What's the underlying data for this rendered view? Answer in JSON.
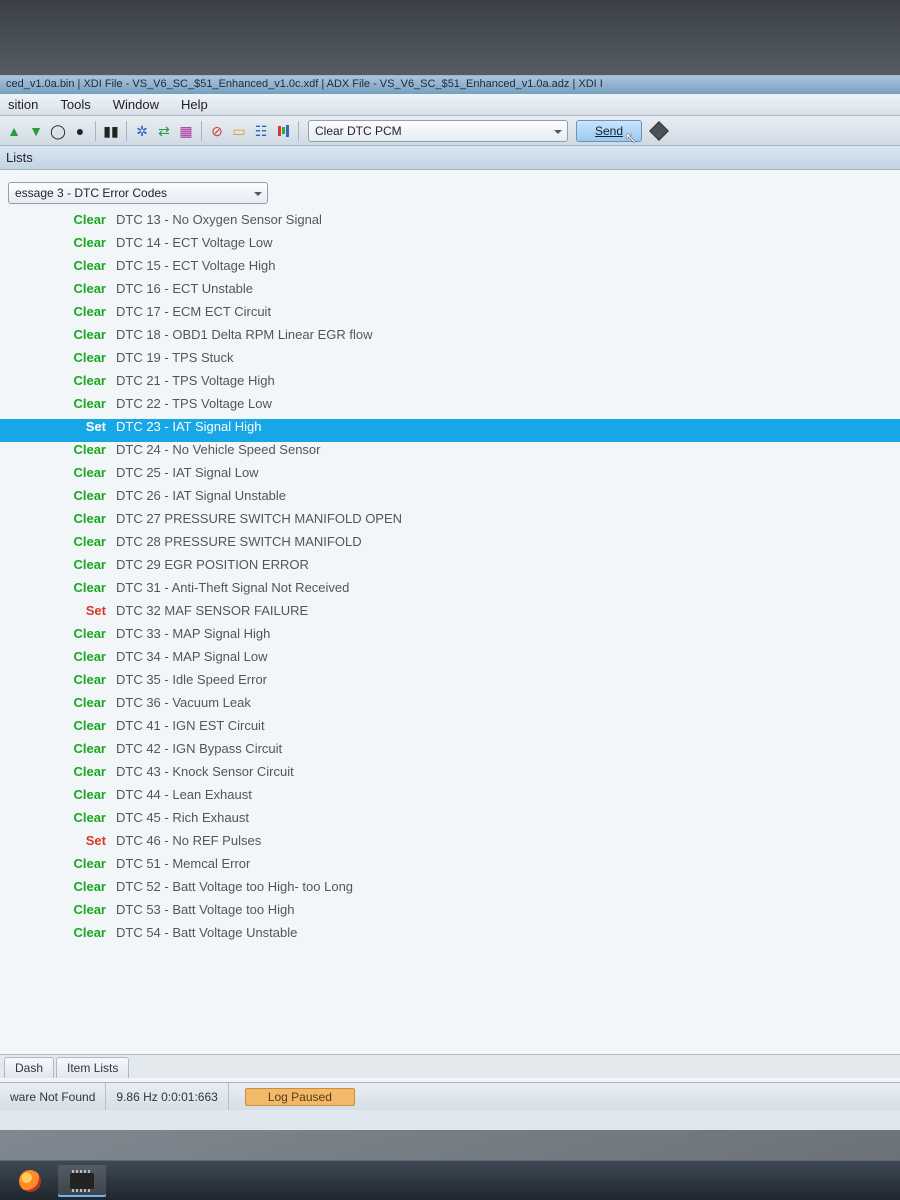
{
  "window_title": "ced_v1.0a.bin | XDI File - VS_V6_SC_$51_Enhanced_v1.0c.xdf | ADX File - VS_V6_SC_$51_Enhanced_v1.0a.adz | XDI I",
  "menu": {
    "items": [
      "sition",
      "Tools",
      "Window",
      "Help"
    ]
  },
  "toolbar": {
    "combo_value": "Clear DTC PCM",
    "send_label": "Send"
  },
  "tabstrip_top_label": "Lists",
  "message_combo": "essage 3 - DTC Error Codes",
  "dtc_rows": [
    {
      "status": "Clear",
      "desc": "DTC 13 - No Oxygen Sensor Signal"
    },
    {
      "status": "Clear",
      "desc": "DTC 14 - ECT Voltage  Low"
    },
    {
      "status": "Clear",
      "desc": "DTC 15 - ECT Voltage High"
    },
    {
      "status": "Clear",
      "desc": "DTC 16 - ECT Unstable"
    },
    {
      "status": "Clear",
      "desc": "DTC 17 - ECM ECT Circuit"
    },
    {
      "status": "Clear",
      "desc": "DTC 18 - OBD1 Delta RPM Linear EGR flow"
    },
    {
      "status": "Clear",
      "desc": "DTC 19 - TPS Stuck"
    },
    {
      "status": "Clear",
      "desc": "DTC 21 - TPS Voltage High"
    },
    {
      "status": "Clear",
      "desc": "DTC 22 - TPS Voltage Low"
    },
    {
      "status": "Set",
      "desc": "DTC 23 - IAT Signal High",
      "selected": true
    },
    {
      "status": "Clear",
      "desc": "DTC 24 - No Vehicle Speed Sensor"
    },
    {
      "status": "Clear",
      "desc": "DTC 25 - IAT Signal Low"
    },
    {
      "status": "Clear",
      "desc": "DTC 26 - IAT Signal Unstable"
    },
    {
      "status": "Clear",
      "desc": "DTC 27  PRESSURE SWITCH MANIFOLD OPEN"
    },
    {
      "status": "Clear",
      "desc": "DTC 28  PRESSURE SWITCH MANIFOLD"
    },
    {
      "status": "Clear",
      "desc": "DTC 29  EGR POSITION ERROR"
    },
    {
      "status": "Clear",
      "desc": "DTC 31 - Anti-Theft Signal Not Received"
    },
    {
      "status": "Set",
      "desc": "DTC 32  MAF SENSOR FAILURE"
    },
    {
      "status": "Clear",
      "desc": "DTC 33 - MAP Signal High"
    },
    {
      "status": "Clear",
      "desc": "DTC 34 - MAP Signal Low"
    },
    {
      "status": "Clear",
      "desc": "DTC 35 - Idle Speed Error"
    },
    {
      "status": "Clear",
      "desc": "DTC 36 - Vacuum Leak"
    },
    {
      "status": "Clear",
      "desc": "DTC 41 - IGN EST Circuit"
    },
    {
      "status": "Clear",
      "desc": "DTC 42 - IGN Bypass Circuit"
    },
    {
      "status": "Clear",
      "desc": "DTC 43 - Knock Sensor Circuit"
    },
    {
      "status": "Clear",
      "desc": "DTC 44 - Lean Exhaust"
    },
    {
      "status": "Clear",
      "desc": "DTC 45 - Rich Exhaust"
    },
    {
      "status": "Set",
      "desc": "DTC 46 - No REF Pulses"
    },
    {
      "status": "Clear",
      "desc": "DTC 51 - Memcal Error"
    },
    {
      "status": "Clear",
      "desc": "DTC 52 - Batt Voltage too High- too Long"
    },
    {
      "status": "Clear",
      "desc": "DTC 53 - Batt Voltage too High"
    },
    {
      "status": "Clear",
      "desc": "DTC 54 - Batt Voltage Unstable"
    }
  ],
  "bottom_tabs": [
    "Dash",
    "Item Lists"
  ],
  "status": {
    "hw": "ware Not Found",
    "rate": "9.86 Hz  0:0:01:663",
    "log": "Log Paused"
  }
}
